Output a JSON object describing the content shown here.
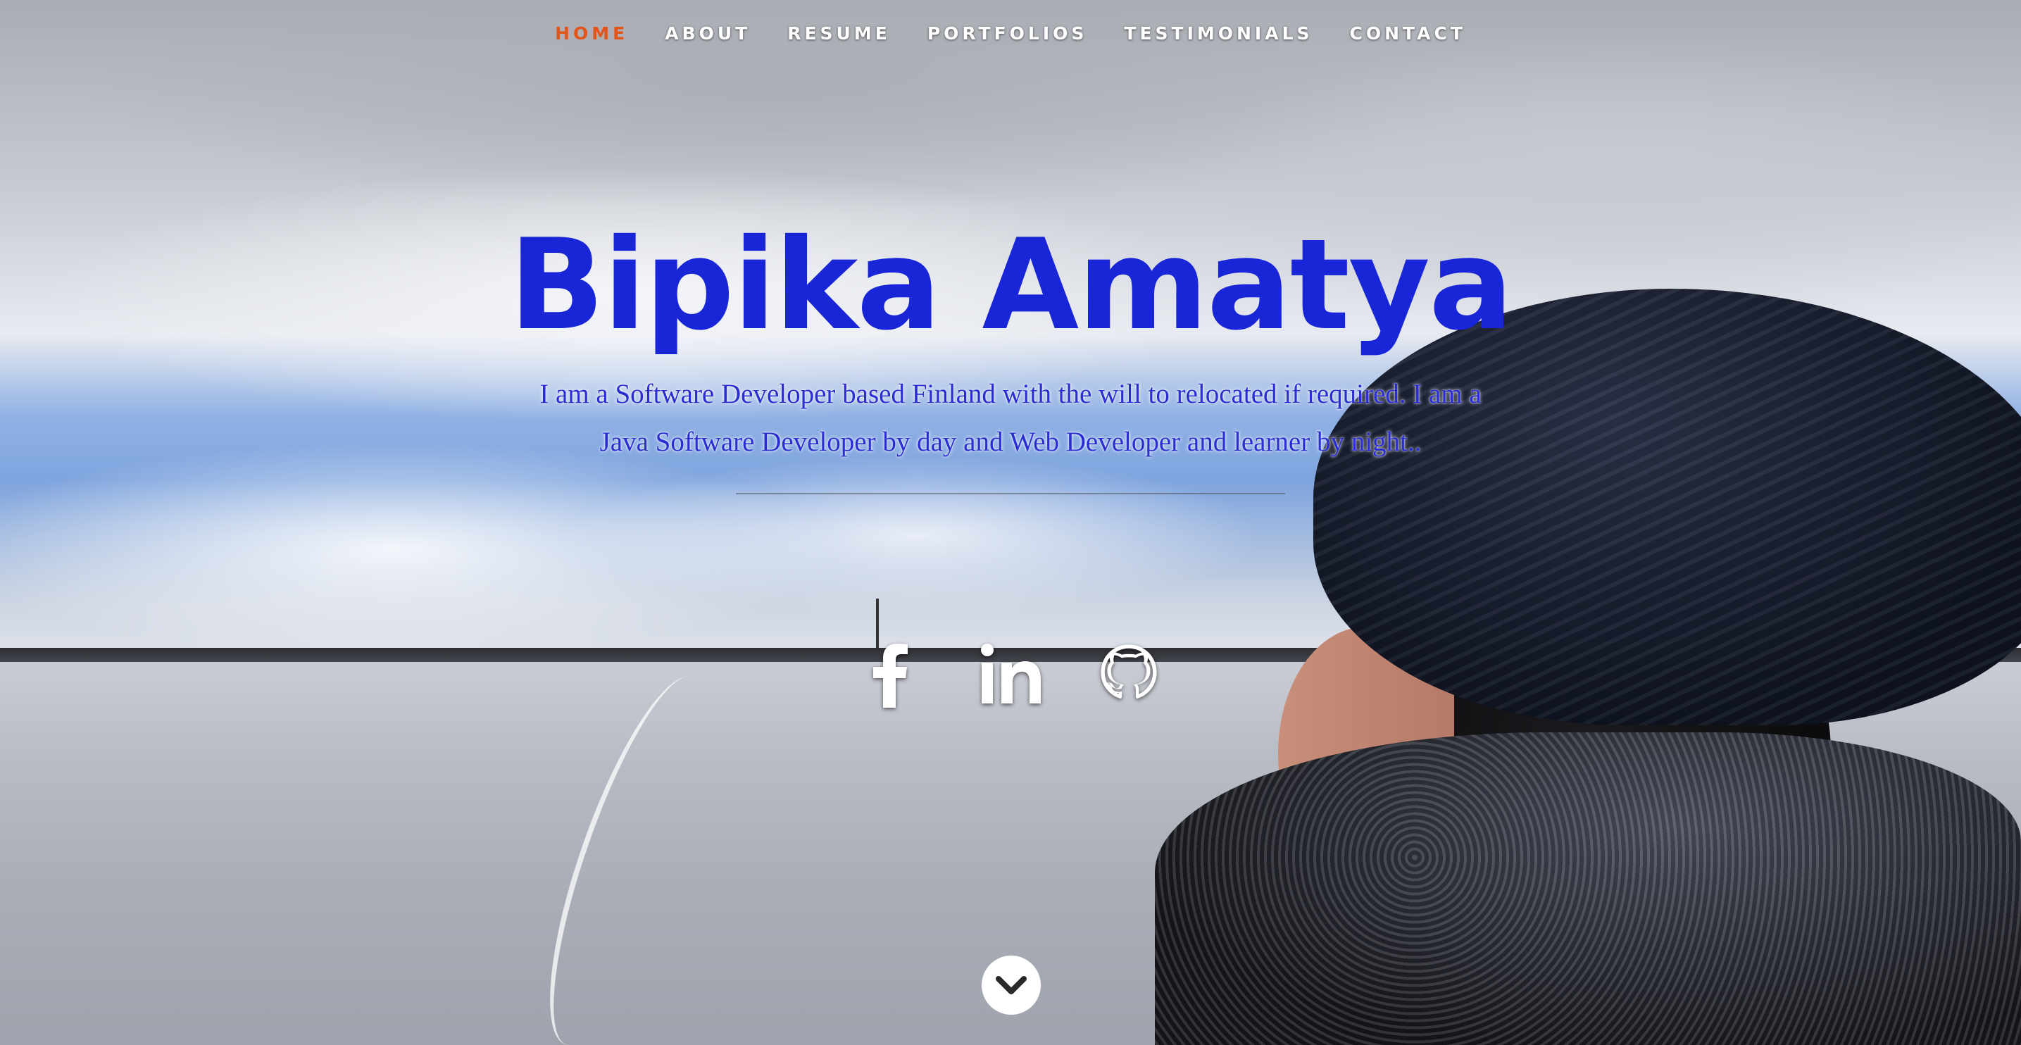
{
  "nav": {
    "items": [
      {
        "label": "HOME",
        "current": true
      },
      {
        "label": "ABOUT",
        "current": false
      },
      {
        "label": "RESUME",
        "current": false
      },
      {
        "label": "PORTFOLIOS",
        "current": false
      },
      {
        "label": "TESTIMONIALS",
        "current": false
      },
      {
        "label": "CONTACT",
        "current": false
      }
    ]
  },
  "banner": {
    "name": "Bipika Amatya",
    "bio": "I am a Software Developer based Finland with the will to relocated if required. I am a Java Software Developer by day and Web Developer and learner by night.."
  },
  "social": {
    "icons": [
      "facebook-icon",
      "linkedin-icon",
      "github-icon"
    ]
  },
  "scroll": {
    "icon": "chevron-down-icon"
  },
  "colors": {
    "nav_current": "#e2551a",
    "nav_text": "#ffffff",
    "name": "#1826d8",
    "bio": "#2a2ed2"
  }
}
